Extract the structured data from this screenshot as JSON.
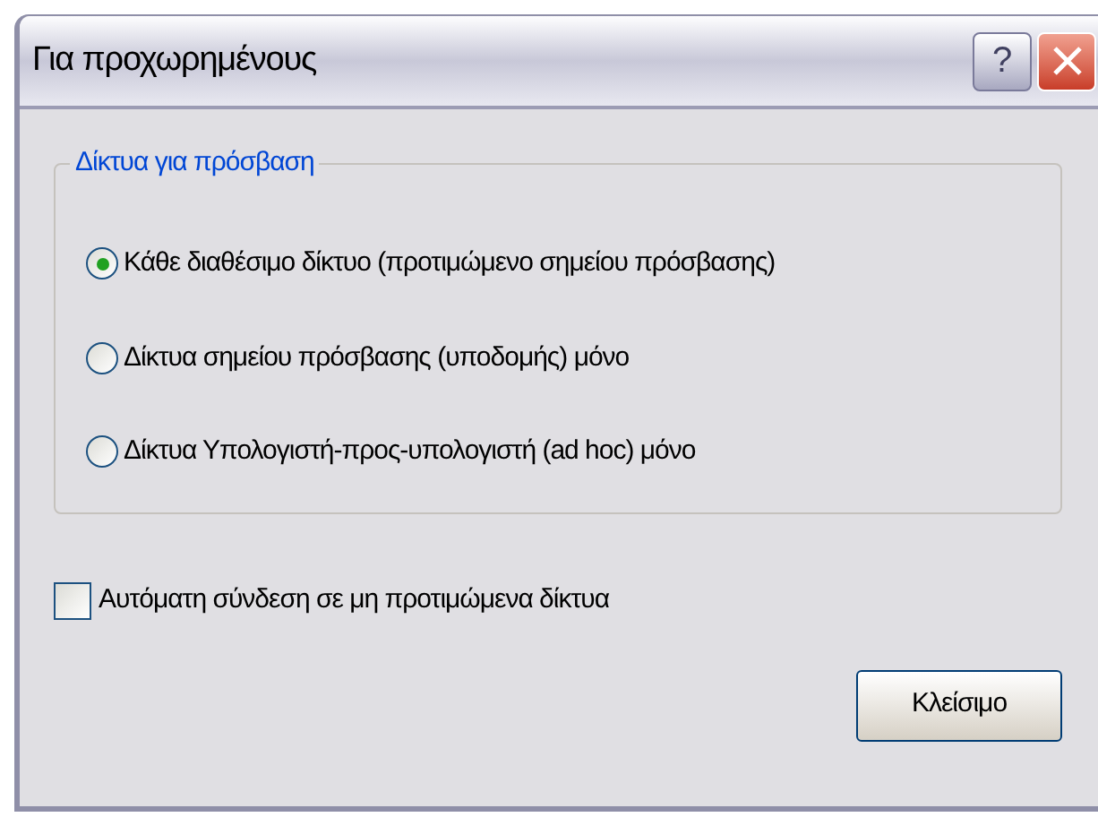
{
  "window": {
    "title": "Για προχωρημένους",
    "title_buttons": [
      {
        "kind": "help",
        "label": "?"
      },
      {
        "kind": "close"
      }
    ]
  },
  "group": {
    "title": "Δίκτυα για πρόσβαση",
    "options": [
      {
        "label": "Κάθε διαθέσιμο δίκτυο (προτιμώμενο σημείου πρόσβασης)",
        "selected": true
      },
      {
        "label": "Δίκτυα σημείου πρόσβασης (υποδομής) μόνο",
        "selected": false
      },
      {
        "label": "Δίκτυα Υπολογιστή-προς-υπολογιστή (ad hoc) μόνο",
        "selected": false
      }
    ]
  },
  "checkbox": {
    "label": "Αυτόματη σύνδεση σε μη προτιμώμενα δίκτυα",
    "checked": false
  },
  "buttons": [
    "Κλείσιμο"
  ]
}
